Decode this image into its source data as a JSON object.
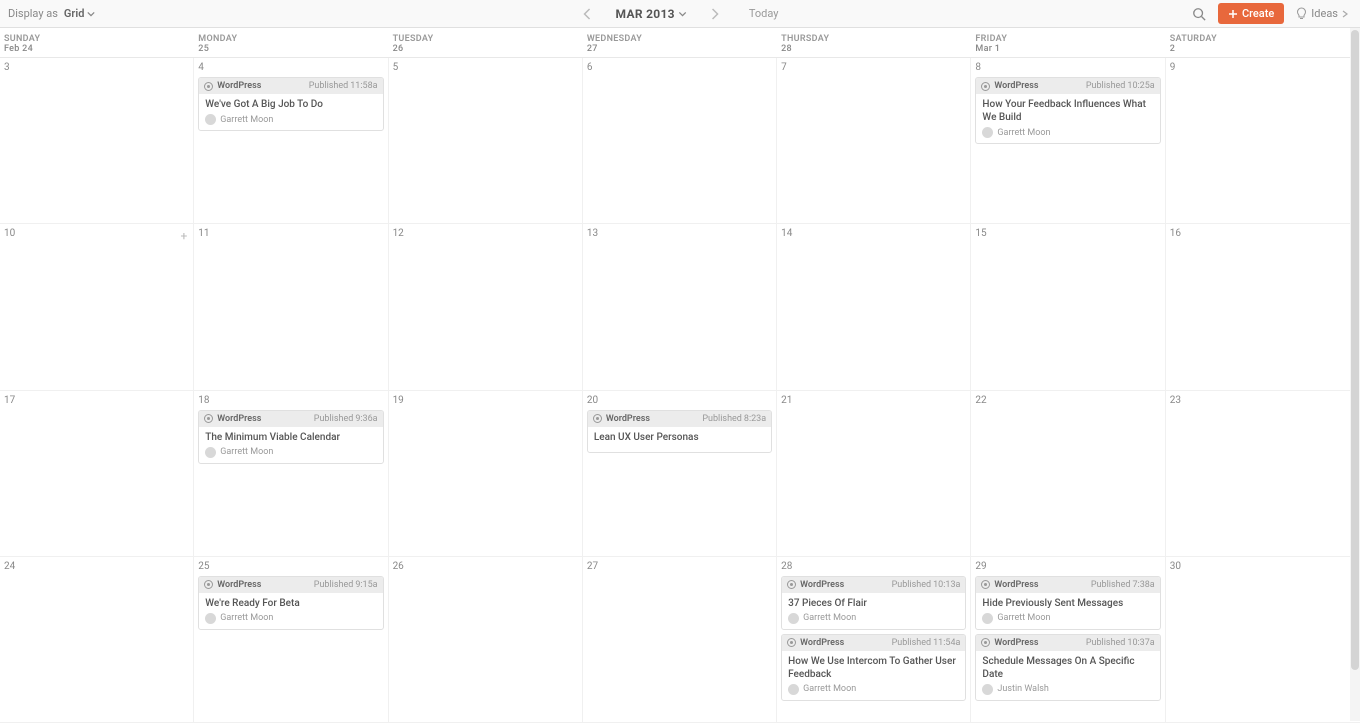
{
  "toolbar": {
    "display_as_label": "Display as",
    "display_mode": "Grid",
    "month": "MAR 2013",
    "today_label": "Today",
    "create_label": "Create",
    "ideas_label": "Ideas"
  },
  "headers": [
    {
      "day": "SUNDAY",
      "sub": "Feb 24"
    },
    {
      "day": "MONDAY",
      "sub": "25"
    },
    {
      "day": "TUESDAY",
      "sub": "26"
    },
    {
      "day": "WEDNESDAY",
      "sub": "27"
    },
    {
      "day": "THURSDAY",
      "sub": "28"
    },
    {
      "day": "FRIDAY",
      "sub": "Mar 1"
    },
    {
      "day": "SATURDAY",
      "sub": "2"
    }
  ],
  "labels": {
    "published": "Published"
  },
  "weeks": [
    {
      "days": [
        {
          "num": "3",
          "cards": []
        },
        {
          "num": "4",
          "cards": [
            {
              "source": "WordPress",
              "time": "11:58a",
              "title": "We've Got A Big Job To Do",
              "author": "Garrett Moon"
            }
          ]
        },
        {
          "num": "5",
          "cards": []
        },
        {
          "num": "6",
          "cards": []
        },
        {
          "num": "7",
          "cards": []
        },
        {
          "num": "8",
          "cards": [
            {
              "source": "WordPress",
              "time": "10:25a",
              "title": "How Your Feedback Influences What We Build",
              "author": "Garrett Moon"
            }
          ]
        },
        {
          "num": "9",
          "cards": []
        }
      ]
    },
    {
      "days": [
        {
          "num": "10",
          "cards": [],
          "show_plus": true
        },
        {
          "num": "11",
          "cards": []
        },
        {
          "num": "12",
          "cards": []
        },
        {
          "num": "13",
          "cards": []
        },
        {
          "num": "14",
          "cards": []
        },
        {
          "num": "15",
          "cards": []
        },
        {
          "num": "16",
          "cards": []
        }
      ]
    },
    {
      "days": [
        {
          "num": "17",
          "cards": []
        },
        {
          "num": "18",
          "cards": [
            {
              "source": "WordPress",
              "time": "9:36a",
              "title": "The Minimum Viable Calendar",
              "author": "Garrett Moon"
            }
          ]
        },
        {
          "num": "19",
          "cards": []
        },
        {
          "num": "20",
          "cards": [
            {
              "source": "WordPress",
              "time": "8:23a",
              "title": "Lean UX User Personas",
              "author": ""
            }
          ]
        },
        {
          "num": "21",
          "cards": []
        },
        {
          "num": "22",
          "cards": []
        },
        {
          "num": "23",
          "cards": []
        }
      ]
    },
    {
      "days": [
        {
          "num": "24",
          "cards": []
        },
        {
          "num": "25",
          "cards": [
            {
              "source": "WordPress",
              "time": "9:15a",
              "title": "We're Ready For Beta",
              "author": "Garrett Moon"
            }
          ]
        },
        {
          "num": "26",
          "cards": []
        },
        {
          "num": "27",
          "cards": []
        },
        {
          "num": "28",
          "cards": [
            {
              "source": "WordPress",
              "time": "10:13a",
              "title": "37 Pieces Of Flair",
              "author": "Garrett Moon"
            },
            {
              "source": "WordPress",
              "time": "11:54a",
              "title": "How We Use Intercom To Gather User Feedback",
              "author": "Garrett Moon"
            }
          ]
        },
        {
          "num": "29",
          "cards": [
            {
              "source": "WordPress",
              "time": "7:38a",
              "title": "Hide Previously Sent Messages",
              "author": "Garrett Moon"
            },
            {
              "source": "WordPress",
              "time": "10:37a",
              "title": "Schedule Messages On A Specific Date",
              "author": "Justin Walsh"
            }
          ]
        },
        {
          "num": "30",
          "cards": []
        }
      ]
    }
  ]
}
